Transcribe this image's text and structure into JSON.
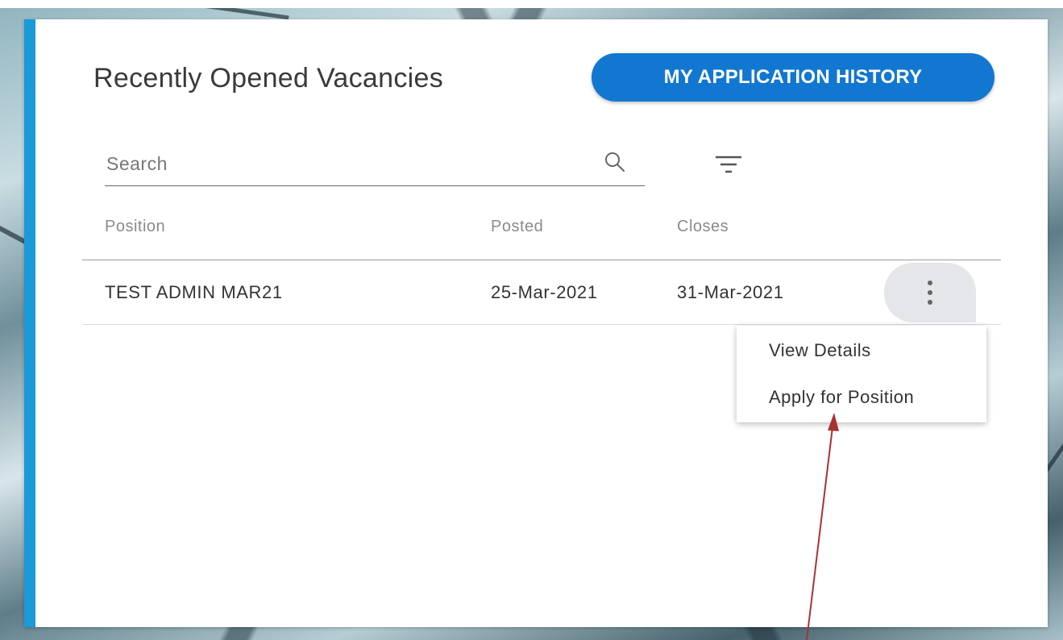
{
  "page": {
    "title": "Recently Opened Vacancies",
    "history_button": "MY APPLICATION HISTORY"
  },
  "search": {
    "placeholder": "Search",
    "value": ""
  },
  "table": {
    "columns": [
      "Position",
      "Posted",
      "Closes"
    ],
    "rows": [
      {
        "position": "TEST ADMIN MAR21",
        "posted": "25-Mar-2021",
        "closes": "31-Mar-2021"
      }
    ]
  },
  "row_menu": {
    "items": [
      "View Details",
      "Apply for Position"
    ]
  },
  "icons": {
    "search": "search-icon",
    "filter": "filter-icon",
    "row_actions": "more-vertical-icon"
  },
  "colors": {
    "accent": "#1177d1",
    "card_border": "#1a9ad6",
    "annotation_arrow": "#a83232"
  }
}
